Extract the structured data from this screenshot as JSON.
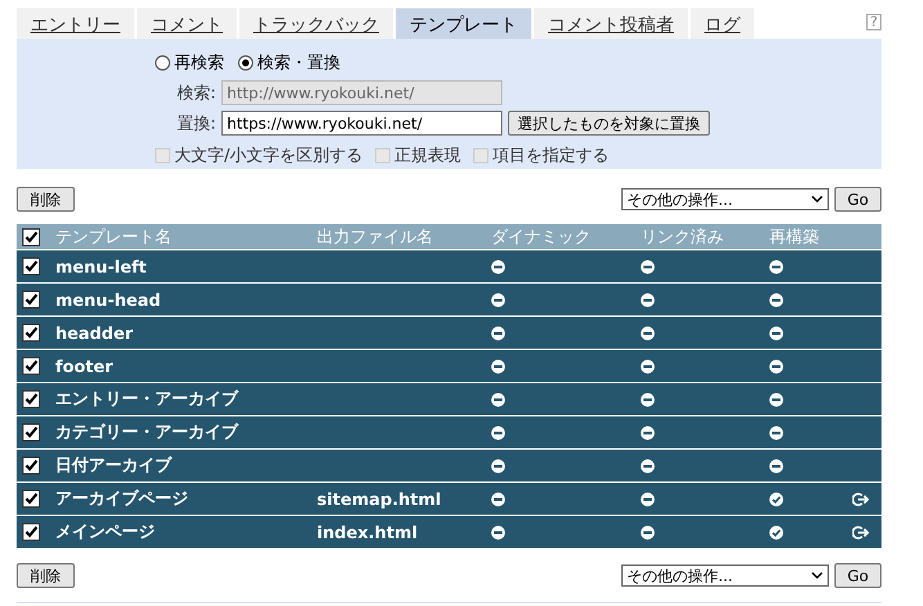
{
  "tabs": [
    {
      "label": "エントリー",
      "selected": false
    },
    {
      "label": "コメント",
      "selected": false
    },
    {
      "label": "トラックバック",
      "selected": false
    },
    {
      "label": "テンプレート",
      "selected": true
    },
    {
      "label": "コメント投稿者",
      "selected": false
    },
    {
      "label": "ログ",
      "selected": false
    }
  ],
  "help": "?",
  "search_panel": {
    "modes": [
      {
        "label": "再検索",
        "selected": false
      },
      {
        "label": "検索・置換",
        "selected": true
      }
    ],
    "search": {
      "label": "検索:",
      "value": "http://www.ryokouki.net/",
      "disabled": true
    },
    "replace": {
      "label": "置換:",
      "value": "https://www.ryokouki.net/",
      "disabled": false
    },
    "replace_button": "選択したものを対象に置換",
    "options": [
      {
        "label": "大文字/小文字を区別する",
        "checked": false,
        "disabled": true
      },
      {
        "label": "正規表現",
        "checked": false,
        "disabled": true
      },
      {
        "label": "項目を指定する",
        "checked": false,
        "disabled": true
      }
    ]
  },
  "top_actions": {
    "delete_button": "削除",
    "action_select": "その他の操作...",
    "go_button": "Go"
  },
  "table": {
    "select_all": true,
    "columns": [
      "テンプレート名",
      "出力ファイル名",
      "ダイナミック",
      "リンク済み",
      "再構築"
    ],
    "rows": [
      {
        "checked": true,
        "name": "menu-left",
        "output": "",
        "dynamic": false,
        "linked": false,
        "rebuild": false,
        "publish": false
      },
      {
        "checked": true,
        "name": "menu-head",
        "output": "",
        "dynamic": false,
        "linked": false,
        "rebuild": false,
        "publish": false
      },
      {
        "checked": true,
        "name": "headder",
        "output": "",
        "dynamic": false,
        "linked": false,
        "rebuild": false,
        "publish": false
      },
      {
        "checked": true,
        "name": "footer",
        "output": "",
        "dynamic": false,
        "linked": false,
        "rebuild": false,
        "publish": false
      },
      {
        "checked": true,
        "name": "エントリー・アーカイブ",
        "output": "",
        "dynamic": false,
        "linked": false,
        "rebuild": false,
        "publish": false
      },
      {
        "checked": true,
        "name": "カテゴリー・アーカイブ",
        "output": "",
        "dynamic": false,
        "linked": false,
        "rebuild": false,
        "publish": false
      },
      {
        "checked": true,
        "name": "日付アーカイブ",
        "output": "",
        "dynamic": false,
        "linked": false,
        "rebuild": false,
        "publish": false
      },
      {
        "checked": true,
        "name": "アーカイブページ",
        "output": "sitemap.html",
        "dynamic": false,
        "linked": false,
        "rebuild": true,
        "publish": true
      },
      {
        "checked": true,
        "name": "メインページ",
        "output": "index.html",
        "dynamic": false,
        "linked": false,
        "rebuild": true,
        "publish": true
      }
    ]
  },
  "bottom_actions": {
    "delete_button": "削除",
    "action_select": "その他の操作...",
    "go_button": "Go"
  }
}
